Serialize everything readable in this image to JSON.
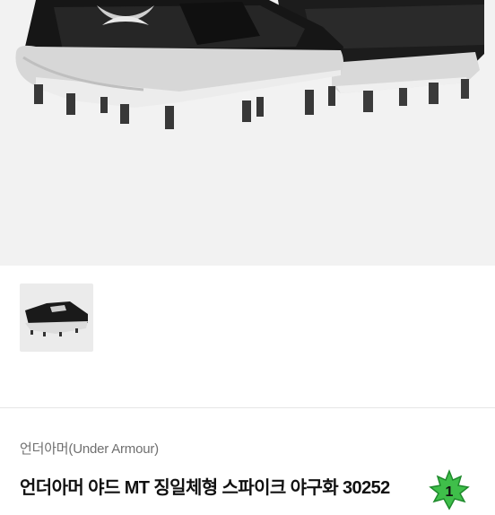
{
  "product": {
    "brand": "언더아머(Under Armour)",
    "title": "언더아머 야드 MT 징일체형 스파이크 야구화 3025",
    "title_suffix": "2"
  },
  "hero_image": {
    "description_icon": "cleat-shoe-photo"
  },
  "thumbnails": [
    {
      "icon": "cleat-shoe-thumbnail"
    }
  ],
  "badge": {
    "label": "1",
    "color": "#3fbf4a"
  },
  "colors": {
    "hero_bg": "#f2f2f2",
    "shoe_upper": "#1b1b1b",
    "sole": "#d4d4d4",
    "text_primary": "#111111",
    "text_secondary": "#6f6f6f"
  }
}
